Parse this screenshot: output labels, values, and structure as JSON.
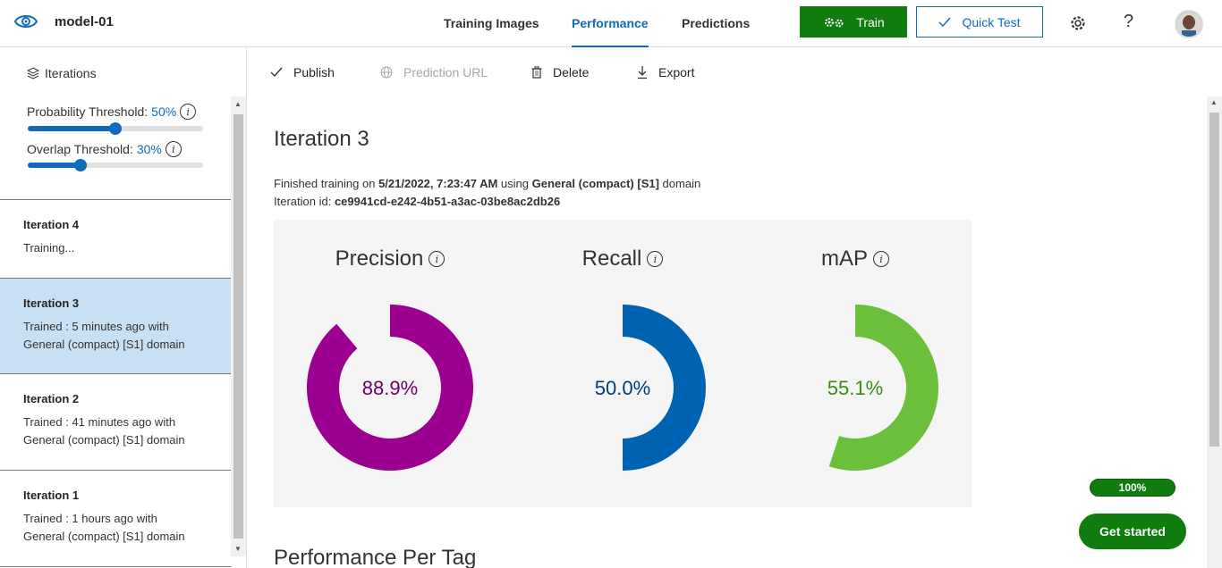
{
  "header": {
    "project_name": "model-01",
    "tabs": [
      {
        "label": "Training Images"
      },
      {
        "label": "Performance"
      },
      {
        "label": "Predictions"
      }
    ],
    "train_label": "Train",
    "quick_test_label": "Quick Test",
    "help_label": "?"
  },
  "sidebar": {
    "header": "Iterations",
    "probability_threshold": {
      "label": "Probability Threshold:",
      "value": "50%",
      "fraction": 0.5
    },
    "overlap_threshold": {
      "label": "Overlap Threshold:",
      "value": "30%",
      "fraction": 0.3
    },
    "iterations": [
      {
        "title": "Iteration 4",
        "desc_line1": "Training...",
        "desc_line2": ""
      },
      {
        "title": "Iteration 3",
        "desc_line1": "Trained : 5 minutes ago with",
        "desc_line2": "General (compact) [S1] domain"
      },
      {
        "title": "Iteration 2",
        "desc_line1": "Trained : 41 minutes ago with",
        "desc_line2": "General (compact) [S1] domain"
      },
      {
        "title": "Iteration 1",
        "desc_line1": "Trained : 1 hours ago with",
        "desc_line2": "General (compact) [S1] domain"
      }
    ]
  },
  "toolbar": {
    "publish": "Publish",
    "prediction_url": "Prediction URL",
    "delete": "Delete",
    "export": "Export"
  },
  "main": {
    "heading": "Iteration 3",
    "finished_prefix": "Finished training on ",
    "finished_date": "5/21/2022, 7:23:47 AM",
    "finished_using": " using ",
    "finished_domain": "General (compact) [S1]",
    "finished_suffix": " domain",
    "iter_id_label": "Iteration id: ",
    "iter_id": "ce9941cd-e242-4b51-a3ac-03be8ac2db26",
    "metrics": [
      {
        "label": "Precision",
        "value": "88.9%",
        "fraction": 0.889,
        "color": "#9c0091",
        "text_color": "#6b0063"
      },
      {
        "label": "Recall",
        "value": "50.0%",
        "fraction": 0.5,
        "color": "#0063b1",
        "text_color": "#003d73"
      },
      {
        "label": "mAP",
        "value": "55.1%",
        "fraction": 0.551,
        "color": "#6bbf3a",
        "text_color": "#3d8a14"
      }
    ],
    "performance_per_tag": "Performance Per Tag"
  },
  "footer": {
    "progress": "100%",
    "get_started": "Get started"
  },
  "colors": {
    "accent": "#0f6cbd",
    "train_green": "#107c10",
    "selected_bg": "#c7e0f4"
  }
}
